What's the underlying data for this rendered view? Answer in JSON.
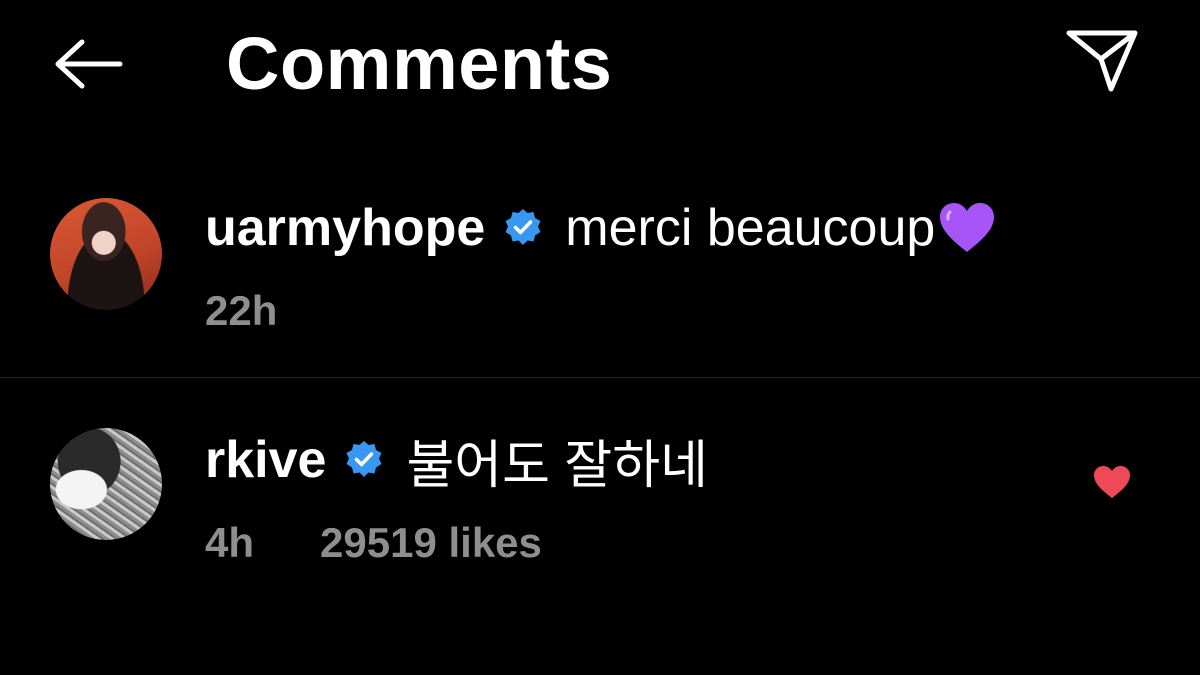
{
  "header": {
    "title": "Comments",
    "back_icon": "arrow-left-icon",
    "share_icon": "paper-plane-icon"
  },
  "colors": {
    "background": "#000000",
    "text": "#ffffff",
    "meta_text": "#8e8e8e",
    "verified_blue": "#3897f0",
    "like_red": "#ed4956",
    "divider": "#262626",
    "emoji_purple": "#a855f7"
  },
  "comments": [
    {
      "username": "uarmyhope",
      "verified": true,
      "text": "merci beaucoup",
      "emoji": "purple-heart",
      "time": "22h",
      "likes": "",
      "liked": false
    },
    {
      "username": "rkive",
      "verified": true,
      "text": "불어도 잘하네",
      "emoji": "",
      "time": "4h",
      "likes": "29519 likes",
      "liked": true
    }
  ]
}
